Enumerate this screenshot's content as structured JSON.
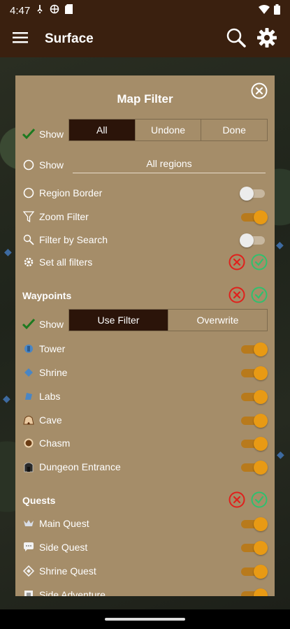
{
  "status": {
    "time": "4:47",
    "icons": [
      "notification-icon",
      "vpn-icon",
      "sd-card-icon",
      "wifi-icon",
      "battery-icon"
    ]
  },
  "app_bar": {
    "title": "Surface",
    "menu_icon": "menu-icon",
    "search_icon": "search-icon",
    "settings_icon": "gear-icon"
  },
  "dialog": {
    "title": "Map Filter",
    "show_label": "Show",
    "show_segments": [
      "All",
      "Undone",
      "Done"
    ],
    "show_selected": "All",
    "region_show_label": "Show",
    "region_value": "All regions",
    "region_border": {
      "label": "Region Border",
      "on": false
    },
    "zoom_filter": {
      "label": "Zoom Filter",
      "on": true
    },
    "filter_by_search": {
      "label": "Filter by Search",
      "on": false
    },
    "set_all_filters": "Set all filters",
    "waypoints": {
      "header": "Waypoints",
      "show_label": "Show",
      "segments": [
        "Use Filter",
        "Overwrite"
      ],
      "selected": "Use Filter",
      "items": [
        {
          "label": "Tower",
          "icon": "tower-icon",
          "on": true
        },
        {
          "label": "Shrine",
          "icon": "shrine-icon",
          "on": true
        },
        {
          "label": "Labs",
          "icon": "labs-icon",
          "on": true
        },
        {
          "label": "Cave",
          "icon": "cave-icon",
          "on": true
        },
        {
          "label": "Chasm",
          "icon": "chasm-icon",
          "on": true
        },
        {
          "label": "Dungeon Entrance",
          "icon": "dungeon-icon",
          "on": true
        }
      ]
    },
    "quests": {
      "header": "Quests",
      "items": [
        {
          "label": "Main Quest",
          "icon": "main-quest-icon",
          "on": true
        },
        {
          "label": "Side Quest",
          "icon": "side-quest-icon",
          "on": true
        },
        {
          "label": "Shrine Quest",
          "icon": "shrine-quest-icon",
          "on": true
        },
        {
          "label": "Side Adventure",
          "icon": "side-adventure-icon",
          "on": true
        }
      ]
    }
  },
  "colors": {
    "app_bar": "#3a200f",
    "dialog": "#a58d69",
    "active_segment": "#2b1409",
    "toggle_on": "#e89a14",
    "clear_red": "#e0201c",
    "check_green": "#2fc06e"
  }
}
